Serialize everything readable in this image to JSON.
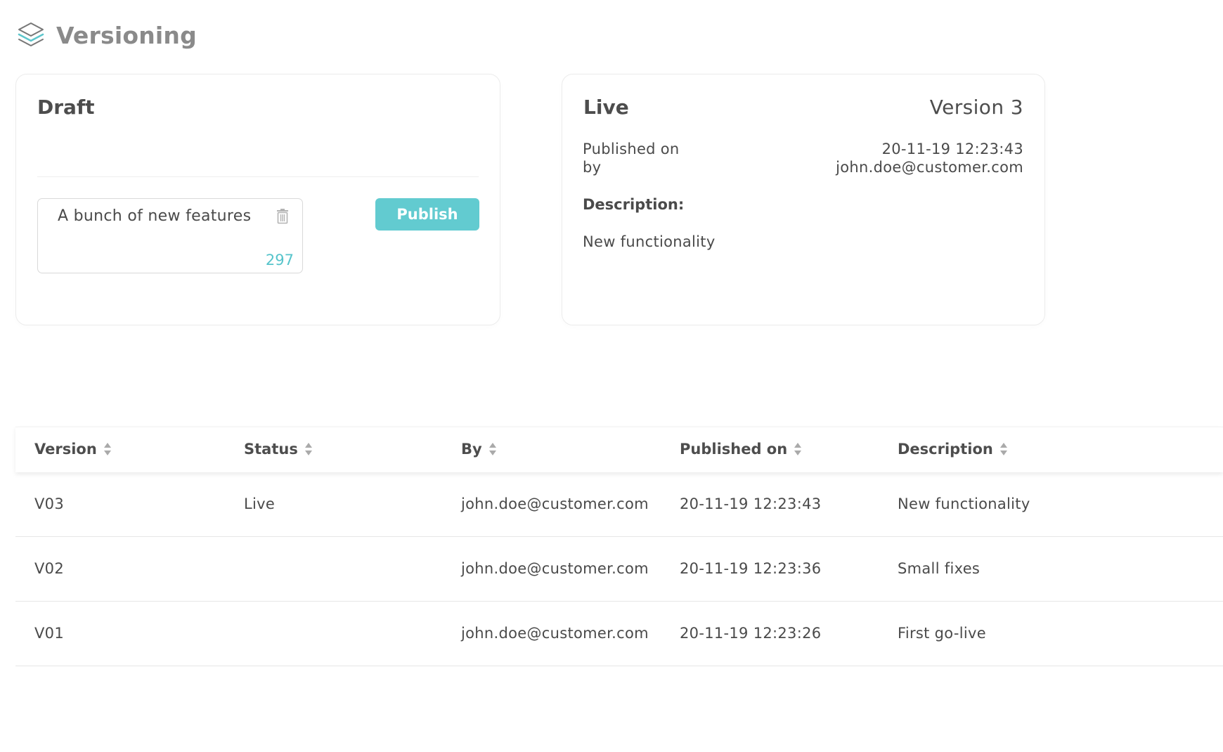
{
  "header": {
    "title": "Versioning",
    "icon": "layers-icon",
    "icon_accent": "#5ec6cc"
  },
  "draft": {
    "title": "Draft",
    "description_value": "A bunch of new features",
    "char_count": "297",
    "publish_label": "Publish",
    "publish_color": "#62cbd0"
  },
  "live": {
    "title": "Live",
    "version": "Version 3",
    "published_on_label": "Published on",
    "by_label": "by",
    "published_on_value": "20-11-19 12:23:43",
    "by_value": "john.doe@customer.com",
    "description_label": "Description:",
    "description_value": "New functionality"
  },
  "table": {
    "columns": [
      "Version",
      "Status",
      "By",
      "Published on",
      "Description"
    ],
    "rows": [
      [
        "V03",
        "Live",
        "john.doe@customer.com",
        "20-11-19 12:23:43",
        "New functionality"
      ],
      [
        "V02",
        "",
        "john.doe@customer.com",
        "20-11-19 12:23:36",
        "Small fixes"
      ],
      [
        "V01",
        "",
        "john.doe@customer.com",
        "20-11-19 12:23:26",
        "First go-live"
      ]
    ]
  }
}
